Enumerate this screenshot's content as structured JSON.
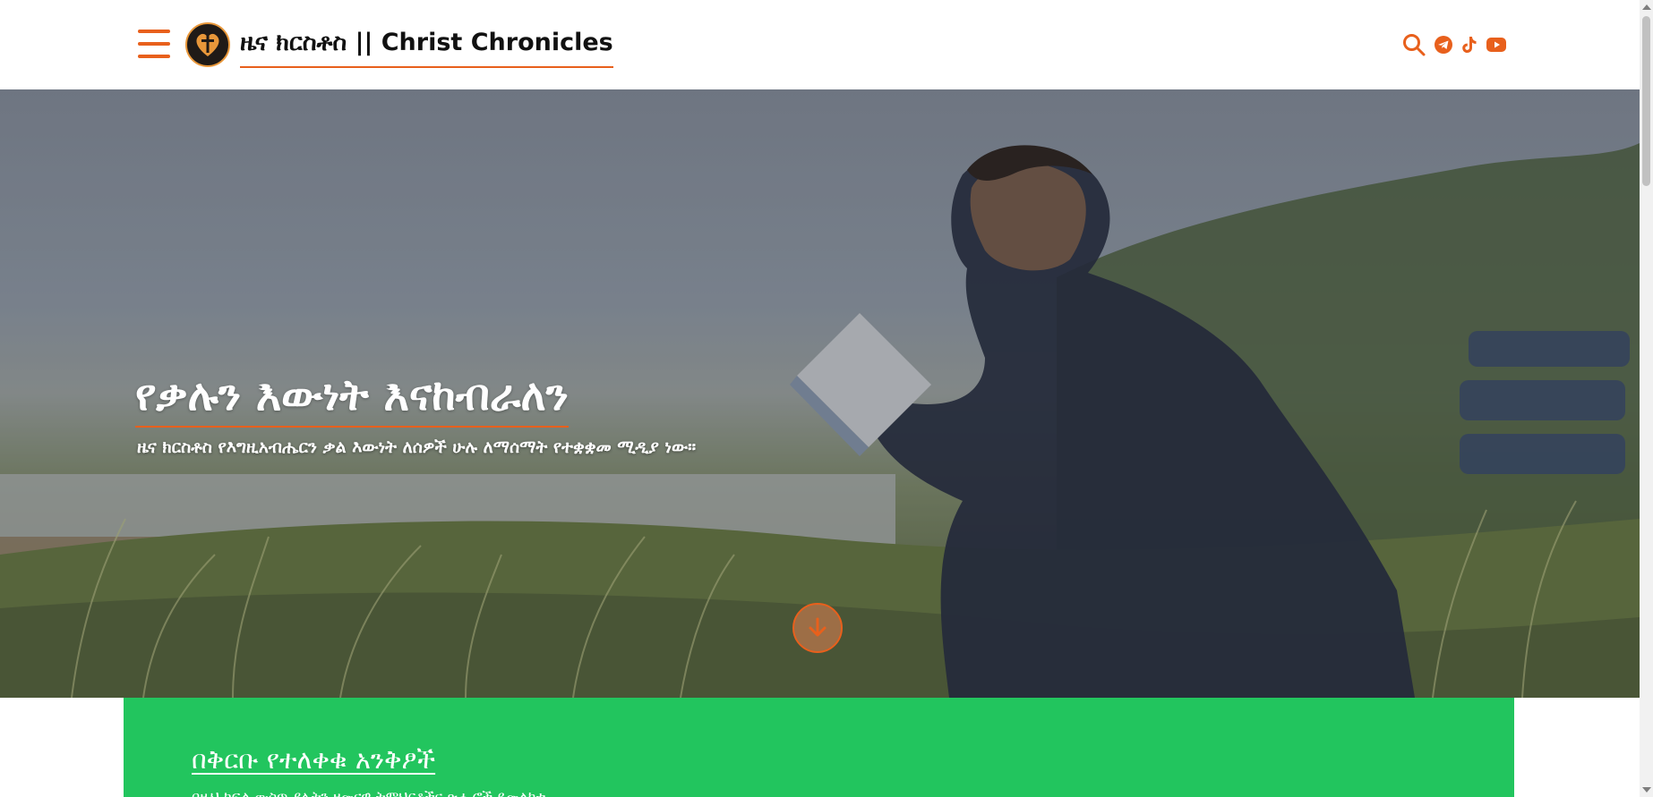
{
  "header": {
    "site_title": "ዜና ክርስቶስ || Christ Chronicles",
    "icons": [
      "menu-icon",
      "logo",
      "search-icon",
      "telegram-icon",
      "tiktok-icon",
      "youtube-icon"
    ]
  },
  "hero": {
    "title": "የቃሉን እውነት እናከብራለን",
    "subtitle": "ዜና ክርስቶስ የእግዚአብሔርን ቃል እውነት ለሰዎች ሁሉ ለማሰማት የተቋቋመ ሚዲያ ነው።",
    "scroll_icon": "arrow-down-icon"
  },
  "panel": {
    "heading": "በቅርቡ የተለቀቁ አንቅፆች",
    "text": "በዚህ ክፍል ውስጥ ያሉትን ዘመናዊ ትምህርቶችና ጽሑፎች ይመልከቱ"
  },
  "colors": {
    "accent": "#e8601c",
    "panel": "#22c55e",
    "text_dark": "#111111"
  }
}
